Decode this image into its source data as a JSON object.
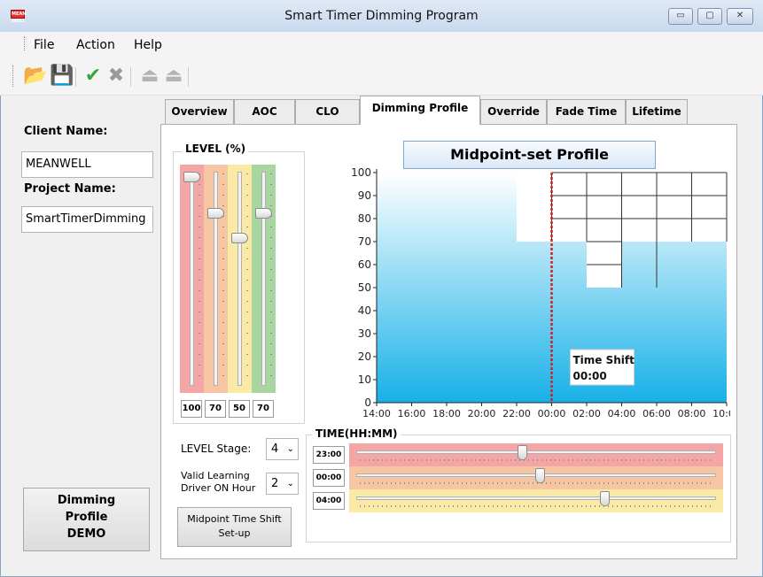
{
  "window": {
    "title": "Smart Timer Dimming Program",
    "icon_label": "MEAN WELL",
    "minimize": "▭",
    "maximize": "▢",
    "close": "✕"
  },
  "menu": [
    "File",
    "Action",
    "Help"
  ],
  "toolbar": {
    "icons": [
      {
        "name": "open-folder-icon",
        "glyph": "📂",
        "color": "#e8a52a"
      },
      {
        "name": "save-icon",
        "glyph": "💾",
        "color": "#2f5aa0"
      },
      {
        "name": "check-icon",
        "glyph": "✔",
        "color": "#3aa53a"
      },
      {
        "name": "cross-icon",
        "glyph": "✖",
        "color": "#9a9a9a"
      },
      {
        "name": "upload-icon",
        "glyph": "⏏",
        "color": "#b3b3b3"
      },
      {
        "name": "download-icon",
        "glyph": "⏏",
        "color": "#b3b3b3"
      }
    ]
  },
  "left_panel": {
    "client_label": "Client Name:",
    "client_value": "MEANWELL",
    "project_label": "Project Name:",
    "project_value": "SmartTimerDimming",
    "demo_button": [
      "Dimming",
      "Profile",
      "DEMO"
    ]
  },
  "tabs": [
    {
      "label": "Overview",
      "active": false
    },
    {
      "label": "AOC",
      "active": false
    },
    {
      "label": "CLO",
      "active": false
    },
    {
      "label": "Dimming Profile",
      "active": true
    },
    {
      "label": "Override",
      "active": false
    },
    {
      "label": "Fade Time",
      "active": false
    },
    {
      "label": "Lifetime",
      "active": false
    }
  ],
  "level_group": {
    "title": "LEVEL (%)",
    "sliders": [
      {
        "value": "100",
        "level": 100,
        "color": "#f4a6a6"
      },
      {
        "value": "70",
        "level": 70,
        "color": "#f6c6a2"
      },
      {
        "value": "50",
        "level": 50,
        "color": "#fbe9a6"
      },
      {
        "value": "70",
        "level": 70,
        "color": "#a8d5a0"
      }
    ]
  },
  "profile_button": "Midpoint-set Profile",
  "chart_data": {
    "type": "area",
    "title": "",
    "xlabel": "TIME(HH:MM)",
    "ylabel": "",
    "ylim": [
      0,
      100
    ],
    "yticks": [
      "0",
      "10",
      "20",
      "30",
      "40",
      "50",
      "60",
      "70",
      "80",
      "90",
      "100"
    ],
    "categories": [
      "14:00",
      "16:00",
      "18:00",
      "20:00",
      "22:00",
      "00:00",
      "02:00",
      "04:00",
      "06:00",
      "08:00",
      "10:00"
    ],
    "series": [
      {
        "values": [
          100,
          100,
          100,
          100,
          100,
          70,
          70,
          50,
          70,
          70,
          70
        ]
      }
    ],
    "midpoint_marker": "00:00",
    "gradient": [
      "#ffffff",
      "#17b1e8"
    ],
    "annotation": {
      "label": "Time Shift",
      "value": "00:00"
    }
  },
  "controls": {
    "level_stage_label": "LEVEL Stage:",
    "level_stage_value": "4",
    "learning_label": [
      "Valid Learning",
      "Driver ON Hour"
    ],
    "learning_value": "2",
    "midpoint_button": [
      "Midpoint Time Shift",
      "Set-up"
    ]
  },
  "time_group": {
    "title": "TIME(HH:MM)",
    "sliders": [
      {
        "value": "23:00",
        "position": 0.46,
        "color": "#f4a6a6"
      },
      {
        "value": "00:00",
        "position": 0.51,
        "color": "#f6c6a2"
      },
      {
        "value": "04:00",
        "position": 0.69,
        "color": "#fbe9a6"
      }
    ]
  }
}
